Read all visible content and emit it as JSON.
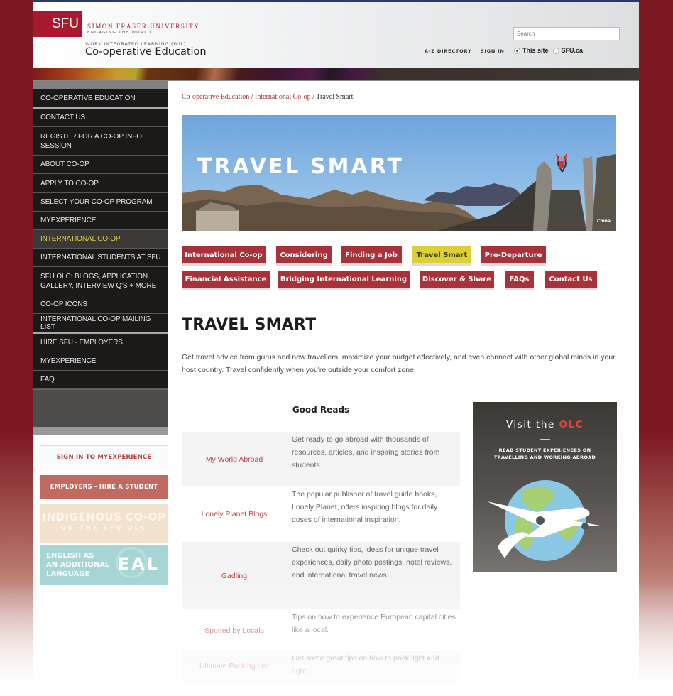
{
  "header": {
    "logo_text": "SFU",
    "university_name": "SIMON FRASER UNIVERSITY",
    "tagline": "ENGAGING THE WORLD",
    "program_label": "WORK INTEGRATED LEARNING (WIL)",
    "department": "Co-operative Education",
    "search_placeholder": "Search",
    "links": [
      "A-Z DIRECTORY",
      "SIGN IN"
    ],
    "scope_options": [
      {
        "label": "This site",
        "selected": true
      },
      {
        "label": "SFU.ca",
        "selected": false
      }
    ]
  },
  "sidebar": {
    "items": [
      {
        "label": "CO-OPERATIVE EDUCATION",
        "active": false
      },
      {
        "label": "CONTACT US",
        "active": false
      },
      {
        "label": "REGISTER FOR A CO-OP INFO SESSION",
        "active": false
      },
      {
        "label": "ABOUT CO-OP",
        "active": false
      },
      {
        "label": "APPLY TO CO-OP",
        "active": false
      },
      {
        "label": "SELECT YOUR CO-OP PROGRAM",
        "active": false
      },
      {
        "label": "MYEXPERIENCE",
        "active": false
      },
      {
        "label": "INTERNATIONAL CO-OP",
        "active": true
      },
      {
        "label": "INTERNATIONAL STUDENTS AT SFU",
        "active": false
      },
      {
        "label": "SFU OLC: BLOGS, APPLICATION GALLERY, INTERVIEW Q'S + MORE",
        "active": false
      },
      {
        "label": "CO-OP ICONS",
        "active": false
      },
      {
        "label": "INTERNATIONAL CO-OP MAILING LIST",
        "active": false
      },
      {
        "label": "HIRE SFU - EMPLOYERS",
        "active": false
      },
      {
        "label": "MYEXPERIENCE",
        "active": false
      },
      {
        "label": "FAQ",
        "active": false
      }
    ],
    "signin_button": "SIGN IN TO MYEXPERIENCE",
    "employers_button": "EMPLOYERS - HIRE A STUDENT",
    "indigenous_promo": {
      "line1": "INDIGENOUS CO-OP",
      "line2": "— ON THE SFU OLC —"
    },
    "eal_promo": {
      "text": [
        "ENGLISH AS",
        "AN ADDITIONAL",
        "LANGUAGE"
      ],
      "badge": "EAL"
    }
  },
  "breadcrumb": {
    "items": [
      "Co-operative Education",
      "International Co-op"
    ],
    "separator": " / ",
    "current": "Travel Smart"
  },
  "hero": {
    "title": "TRAVEL SMART",
    "caption": "China"
  },
  "tabs": [
    {
      "label": "International Co-op",
      "active": false
    },
    {
      "label": "Considering",
      "active": false
    },
    {
      "label": "Finding a Job",
      "active": false
    },
    {
      "label": "Travel Smart",
      "active": true
    },
    {
      "label": "Pre-Departure",
      "active": false
    },
    {
      "label": "Financial Assistance",
      "active": false
    },
    {
      "label": "Bridging International Learning",
      "active": false
    },
    {
      "label": "Discover & Share",
      "active": false
    },
    {
      "label": "FAQs",
      "active": false
    },
    {
      "label": "Contact Us",
      "active": false
    }
  ],
  "main": {
    "title": "TRAVEL SMART",
    "intro": "Get travel advice from gurus and new travellers, maximize your budget effectively, and even connect with other global minds in your host country. Travel confidently when you're outside your comfort zone.",
    "reads_title": "Good Reads",
    "reads": [
      {
        "name": "My World Abroad",
        "description": "Get ready to go abroad with thousands of resources, articles, and inspiring stories from students."
      },
      {
        "name": "Lonely Planet Blogs",
        "description": "The popular publisher of travel guide books, Lonely Planet, offers inspiring blogs for daily doses of international inspiration."
      },
      {
        "name": "Gadling",
        "description": "Check out quirky tips, ideas for unique travel experiences, daily photo postings, hotel reviews, and international travel news."
      },
      {
        "name": "Spotted by Locals",
        "description": "Tips on how to experience European capital cities like a local."
      },
      {
        "name": "Ultimate Packing List",
        "description": "Get some great tips on how to pack light and right."
      }
    ]
  },
  "olc_promo": {
    "title_prefix": "Visit the ",
    "title_highlight": "OLC",
    "subtitle_line1": "READ STUDENT EXPERIENCES ON",
    "subtitle_line2": "TRAVELLING AND WORKING ABROAD"
  },
  "colors": {
    "brand_red": "#a6192e",
    "tab_red": "#a8323a",
    "tab_active": "#dcd035",
    "nav_active_text": "#d8cf46",
    "link_red": "#b8464c"
  }
}
